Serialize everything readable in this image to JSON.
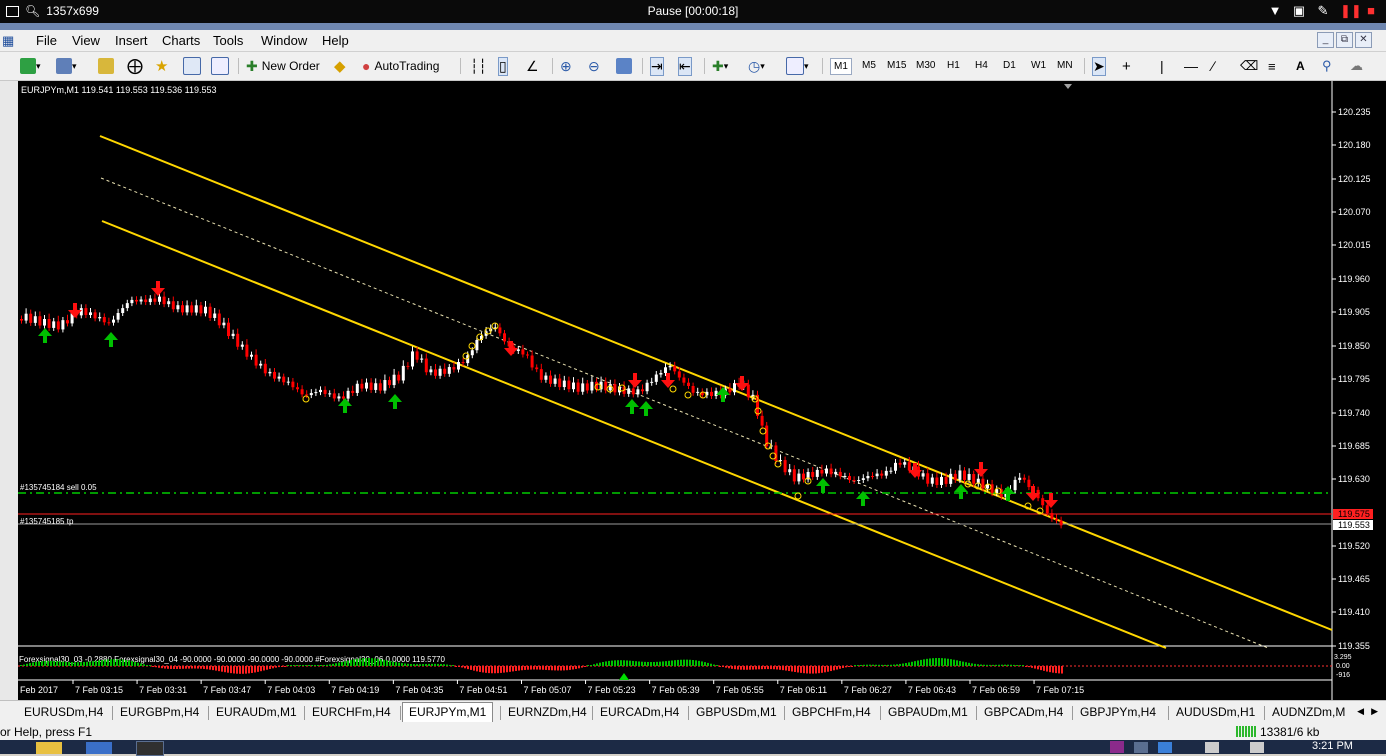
{
  "window": {
    "size_label": "1357x699",
    "status": "Pause [00:00:18]"
  },
  "menu": [
    "File",
    "View",
    "Insert",
    "Charts",
    "Tools",
    "Window",
    "Help"
  ],
  "toolbar": {
    "new_order": "New Order",
    "autotrading": "AutoTrading",
    "timeframes": [
      "M1",
      "M5",
      "M15",
      "M30",
      "H1",
      "H4",
      "D1",
      "W1",
      "MN"
    ],
    "selected_timeframe": "M1",
    "text_tool": "A"
  },
  "chart": {
    "header": "EURJPYm,M1  119.541 119.553 119.536 119.553",
    "price_labels": [
      "120.235",
      "120.180",
      "120.125",
      "120.070",
      "120.015",
      "119.960",
      "119.905",
      "119.850",
      "119.795",
      "119.740",
      "119.685",
      "119.630",
      "119.575",
      "119.553",
      "119.520",
      "119.465",
      "119.410",
      "119.355"
    ],
    "current_price": "119.553",
    "tp_price": "119.575",
    "order_labels": [
      "#135745184 sell 0.05",
      "#135745185 tp"
    ],
    "indicator_header": "Forexsignal30_03 -0.2880  Forexsignal30_04 -90.0000 -90.0000 -90.0000 -90.0000  #Forexsignal30_06 0.0000 119.5770",
    "indicator_scale": [
      "3.295",
      "0.00",
      "-916"
    ],
    "time_labels": [
      "Feb 2017",
      "7 Feb 03:15",
      "7 Feb 03:31",
      "7 Feb 03:47",
      "7 Feb 04:03",
      "7 Feb 04:19",
      "7 Feb 04:35",
      "7 Feb 04:51",
      "7 Feb 05:07",
      "7 Feb 05:23",
      "7 Feb 05:39",
      "7 Feb 05:55",
      "7 Feb 06:11",
      "7 Feb 06:27",
      "7 Feb 06:43",
      "7 Feb 06:59",
      "7 Feb 07:15"
    ]
  },
  "tabs": [
    "EURUSDm,H4",
    "EURGBPm,H4",
    "EURAUDm,M1",
    "EURCHFm,H4",
    "EURJPYm,M1",
    "EURNZDm,H4",
    "EURCADm,H4",
    "GBPUSDm,M1",
    "GBPCHFm,H4",
    "GBPAUDm,M1",
    "GBPCADm,H4",
    "GBPJPYm,H4",
    "AUDUSDm,H1",
    "AUDNZDm,M"
  ],
  "active_tab": "EURJPYm,M1",
  "statusbar": {
    "help": "or Help, press F1",
    "traffic": "13381/6 kb"
  },
  "taskbar": {
    "clock": "3:21 PM"
  },
  "colors": {
    "channel": "#ffd700",
    "up_candle": "#ffffff",
    "down_candle": "#ff0000",
    "up_arrow": "#00c000",
    "down_arrow": "#ff1010",
    "order_line": "#00cc00",
    "tp_line": "#ff2020"
  }
}
